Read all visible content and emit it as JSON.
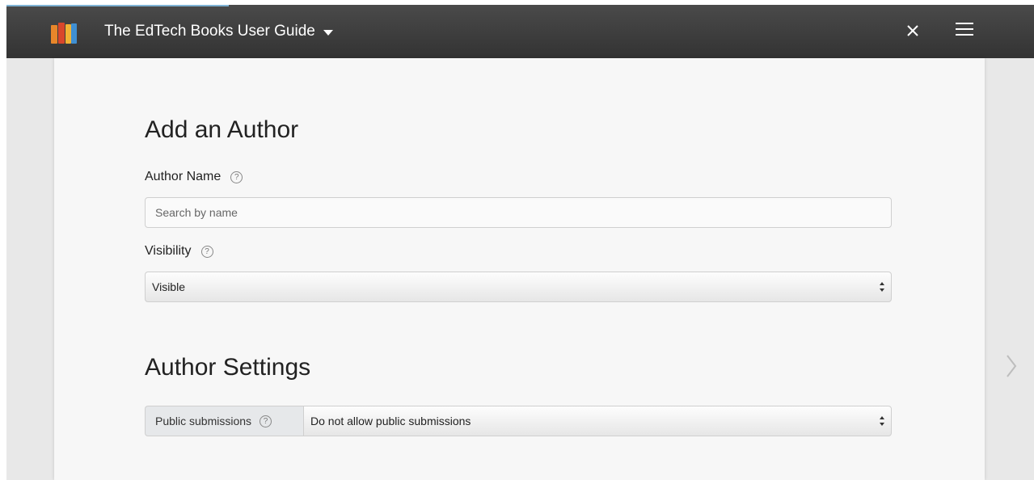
{
  "header": {
    "book_title": "The EdTech Books User Guide",
    "icons": [
      "books-logo-icon",
      "chevron-down-icon",
      "close-icon",
      "menu-icon"
    ]
  },
  "form": {
    "heading": "Add an Author",
    "author_name": {
      "label": "Author Name",
      "placeholder": "Search by name",
      "value": ""
    },
    "visibility": {
      "label": "Visibility",
      "selected": "Visible"
    }
  },
  "settings": {
    "heading": "Author Settings",
    "public_submissions": {
      "label": "Public submissions",
      "selected": "Do not allow public submissions"
    }
  },
  "help_glyph": "?",
  "colors": {
    "topbar": "#3b3b3b",
    "page_bg": "#e8e8e8",
    "paper": "#f7f7f7",
    "accent_strip": "#7fb3d5"
  }
}
